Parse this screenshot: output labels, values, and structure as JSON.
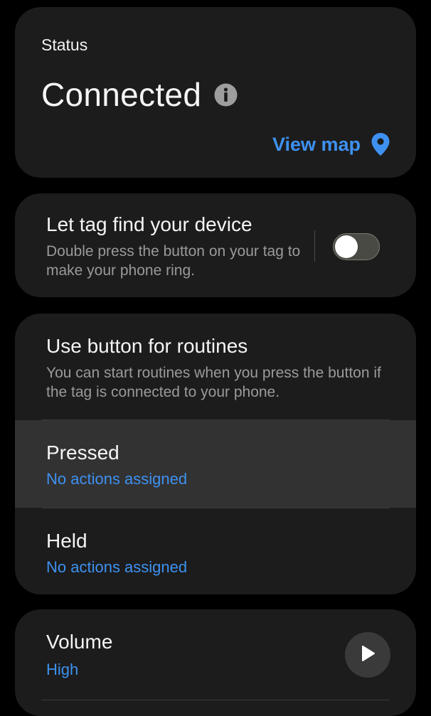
{
  "status": {
    "label": "Status",
    "value": "Connected",
    "view_map_label": "View map"
  },
  "find_device": {
    "title": "Let tag find your device",
    "description": "Double press the button on your tag to make your phone ring.",
    "enabled": false
  },
  "routines": {
    "title": "Use button for routines",
    "description": "You can start routines when you press the button if the tag is connected to your phone.",
    "items": [
      {
        "title": "Pressed",
        "subtitle": "No actions assigned"
      },
      {
        "title": "Held",
        "subtitle": "No actions assigned"
      }
    ]
  },
  "volume": {
    "title": "Volume",
    "value": "High"
  },
  "colors": {
    "accent": "#3e91f0",
    "card_bg": "#1c1c1c",
    "highlight_bg": "#323232",
    "secondary_text": "#9a9a9a"
  },
  "icons": {
    "info": "info-icon",
    "map_pin": "map-pin-icon",
    "play": "play-icon"
  }
}
